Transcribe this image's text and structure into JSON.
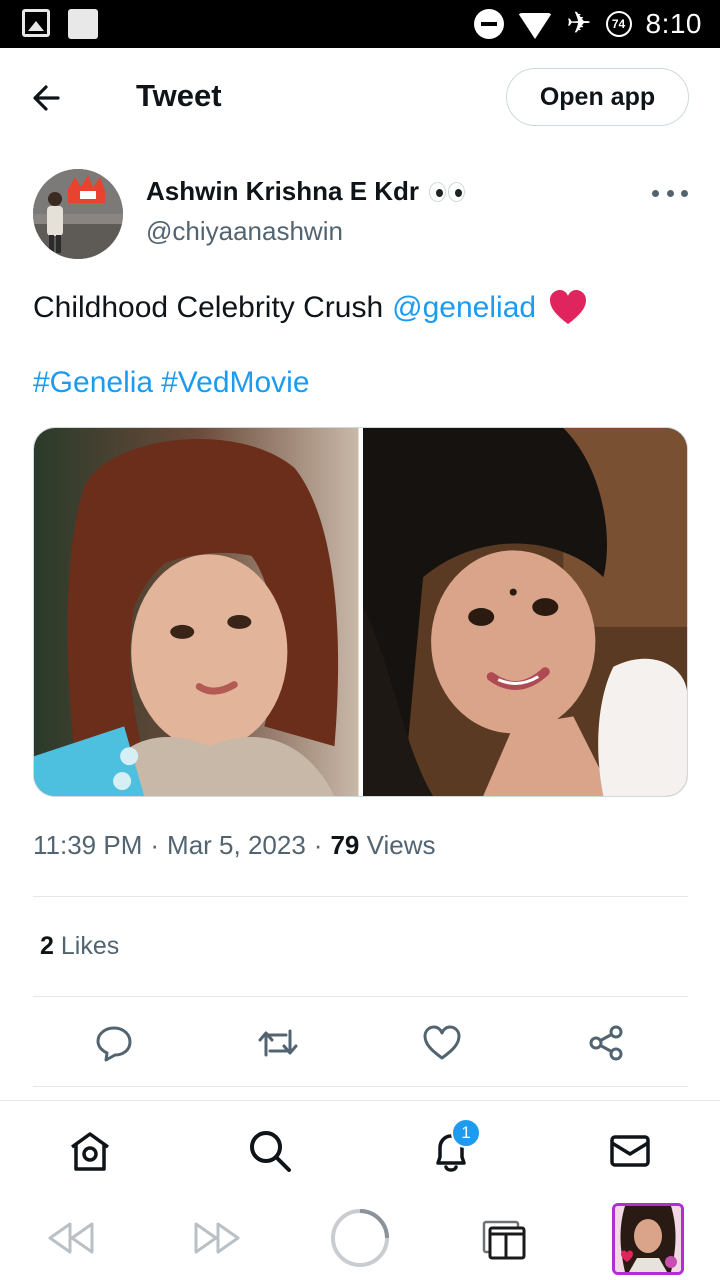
{
  "status_bar": {
    "time": "8:10",
    "battery": "74",
    "icons": [
      "image-icon",
      "square-icon",
      "dnd-icon",
      "wifi-icon",
      "airplane-icon",
      "battery-icon"
    ]
  },
  "header": {
    "title": "Tweet",
    "open_app_label": "Open app"
  },
  "tweet": {
    "author_name": "Ashwin Krishna E Kdr",
    "author_emoji": "eyes-emoji",
    "handle": "@chiyaanashwin",
    "text_prefix": "Childhood Celebrity Crush",
    "mention": "@geneliad",
    "hashtags": [
      "#Genelia",
      "#VedMovie"
    ],
    "time": "11:39 PM",
    "date": "Mar 5, 2023",
    "views_count": "79",
    "views_label": "Views",
    "likes_count": "2",
    "likes_label": "Likes"
  },
  "actions": [
    "reply-icon",
    "retweet-icon",
    "like-icon",
    "share-icon"
  ],
  "bottom_nav": {
    "items": [
      "home-icon",
      "search-icon",
      "notifications-icon",
      "messages-icon"
    ],
    "notification_badge": "1"
  },
  "browser_bar": [
    "back-icon",
    "forward-icon",
    "loading-icon",
    "tabs-icon",
    "tab-thumbnail"
  ],
  "colors": {
    "accent": "#1d9bf0",
    "text": "#0f1419",
    "secondary": "#536471",
    "heart": "#e0245e",
    "tab_border": "#b02fd1"
  }
}
